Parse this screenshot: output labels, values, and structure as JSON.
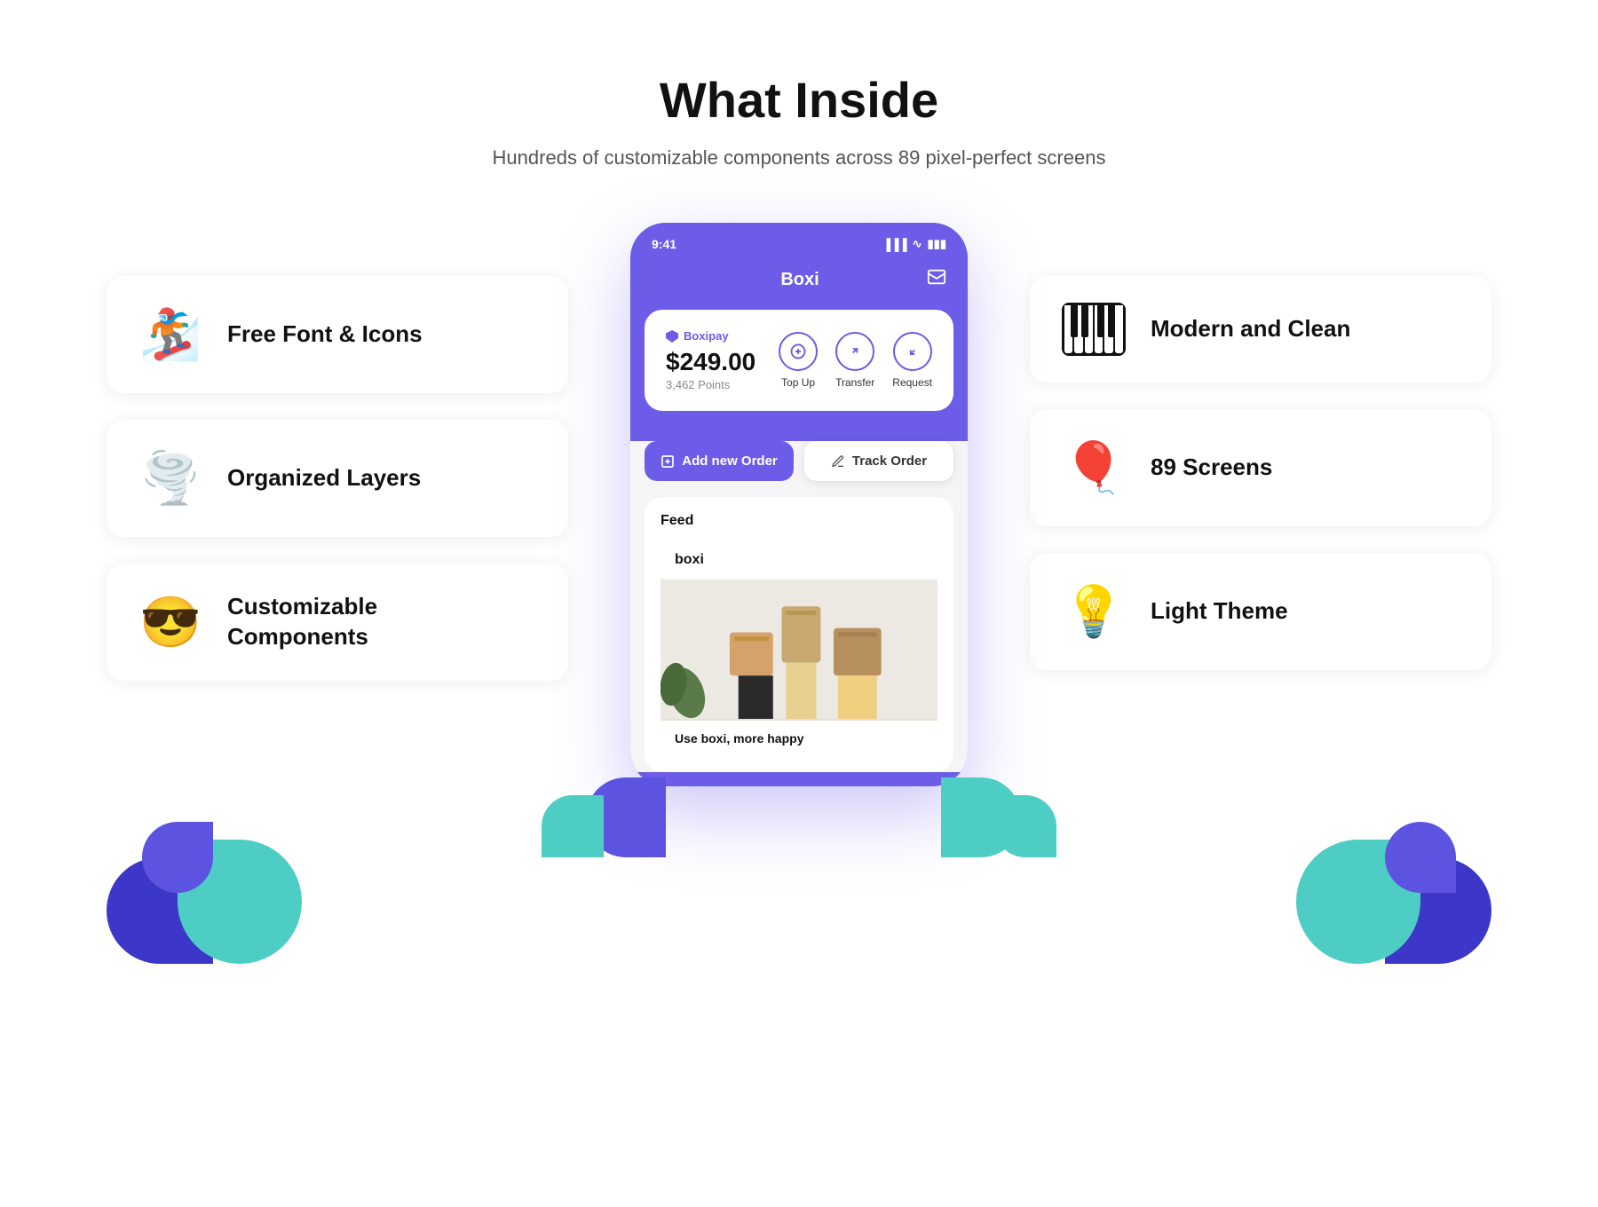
{
  "header": {
    "title": "What Inside",
    "subtitle": "Hundreds of customizable components across 89 pixel-perfect screens"
  },
  "left_features": [
    {
      "id": "free-font-icons",
      "label": "Free Font & Icons",
      "icon_emoji": "🏂",
      "icon_type": "emoji"
    },
    {
      "id": "organized-layers",
      "label": "Organized Layers",
      "icon_emoji": "🌪️",
      "icon_type": "emoji"
    },
    {
      "id": "customizable-components",
      "label_line1": "Customizable",
      "label_line2": "Components",
      "icon_emoji": "😎",
      "icon_type": "emoji"
    }
  ],
  "right_features": [
    {
      "id": "modern-clean",
      "label": "Modern and Clean",
      "icon_type": "piano"
    },
    {
      "id": "89-screens",
      "label": "89 Screens",
      "icon_emoji": "🎈",
      "icon_type": "emoji"
    },
    {
      "id": "light-theme",
      "label": "Light Theme",
      "icon_emoji": "💡",
      "icon_type": "emoji"
    }
  ],
  "phone": {
    "time": "9:41",
    "app_name": "Boxi",
    "brand_name": "Boxipay",
    "amount": "$249.00",
    "points": "3,462 Points",
    "actions": [
      {
        "label": "Top Up",
        "icon": "+"
      },
      {
        "label": "Transfer",
        "icon": "↩"
      },
      {
        "label": "Request",
        "icon": "↪"
      }
    ],
    "btn_add_order": "Add new Order",
    "btn_track_order": "Track Order",
    "feed_title": "Feed",
    "feed_card_name": "boxi",
    "feed_caption": "Use boxi, more happy"
  },
  "colors": {
    "brand_purple": "#6c5ce7",
    "dark_purple": "#5c54e0",
    "deeper_purple": "#3d37c9",
    "teal": "#4ecdc4"
  }
}
